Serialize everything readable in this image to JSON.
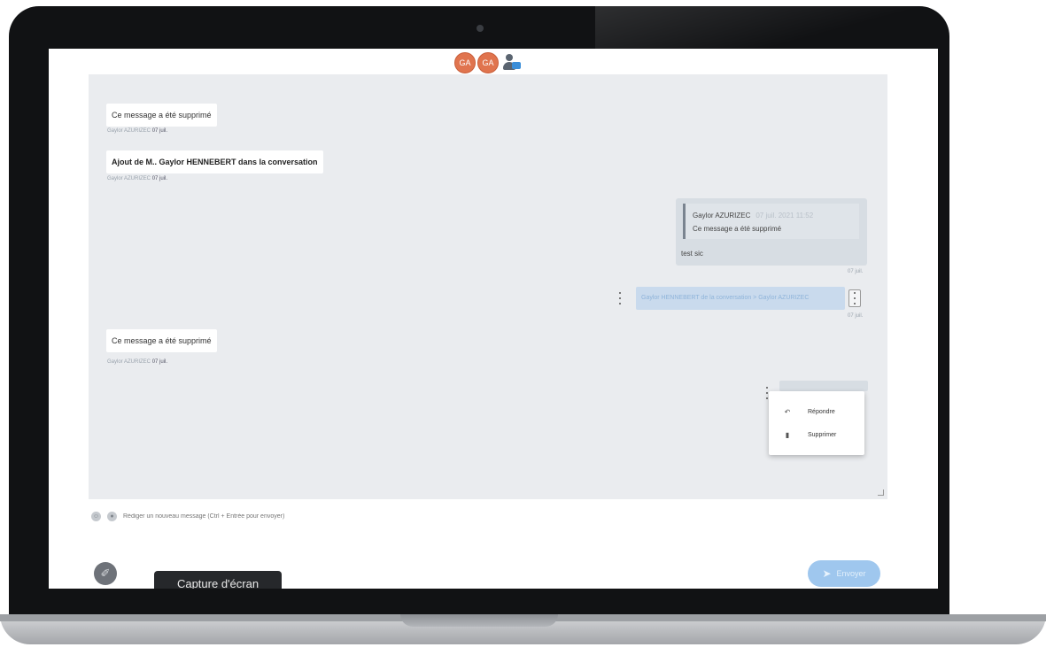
{
  "participants": {
    "avatar1_initials": "GA",
    "avatar2_initials": "GA",
    "group_icon": "user-group-icon"
  },
  "messages": {
    "m1": {
      "text": "Ce message a été supprimé",
      "meta_name": "Gaylor AZURIZEC",
      "meta_date": "07 juil."
    },
    "m2": {
      "text": "Ajout de M.. Gaylor HENNEBERT dans la conversation",
      "meta_name": "Gaylor AZURIZEC",
      "meta_date": "07 juil."
    },
    "quote": {
      "author": "Gaylor AZURIZEC",
      "date": "07 juil. 2021 11:52",
      "quoted_text": "Ce message a été supprimé",
      "reply_text": "test sic",
      "time": "07 juil."
    },
    "system_right": {
      "text": "Gaylor HENNEBERT de la conversation > Gaylor AZURIZEC",
      "time": "07 juil."
    },
    "m3": {
      "text": "Ce message a été supprimé",
      "meta_name": "Gaylor AZURIZEC",
      "meta_date": "07 juil."
    }
  },
  "context_menu": {
    "reply_label": "Répondre",
    "reply_icon": "reply-icon",
    "delete_label": "Supprimer",
    "delete_icon": "trash-icon"
  },
  "composer": {
    "placeholder": "Rédiger un nouveau message (Ctrl + Entrée pour envoyer)",
    "emoji_icon": "emoji-icon",
    "gif_icon": "gif-icon",
    "attach_icon": "paperclip-icon",
    "send_label": "Envoyer",
    "send_icon": "paper-plane-icon"
  },
  "tooltip": {
    "text": "Capture d'écran"
  }
}
